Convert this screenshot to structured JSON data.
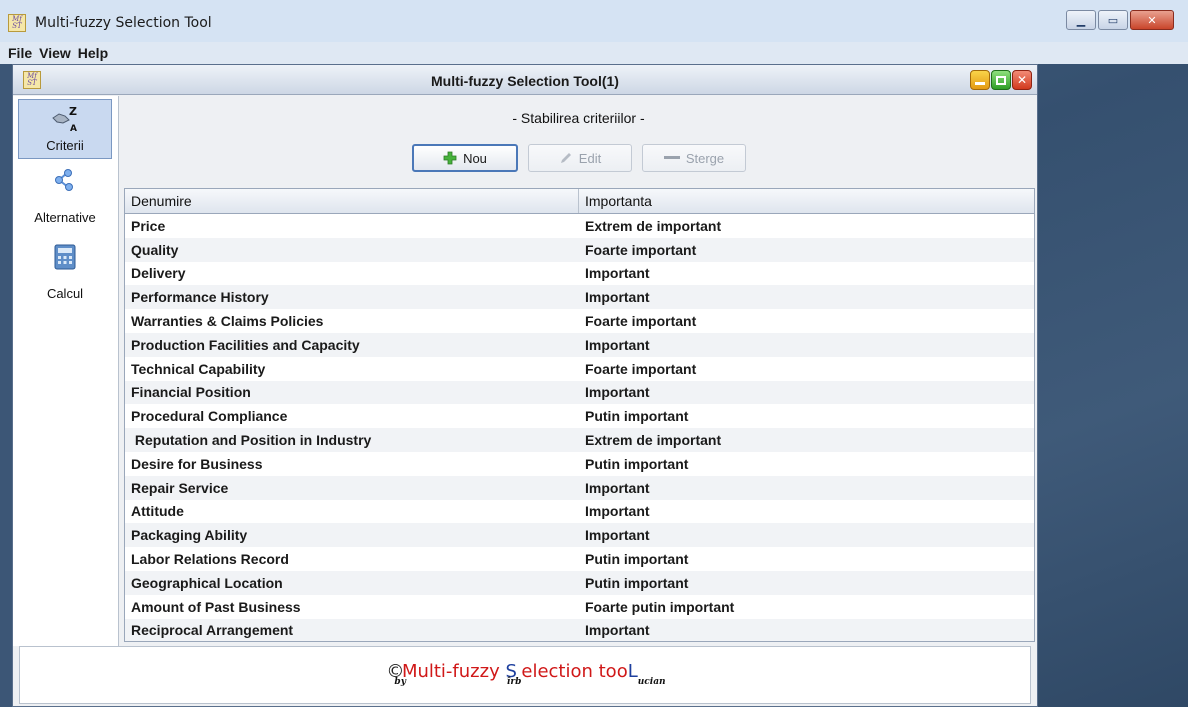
{
  "window": {
    "title": "Multi-fuzzy Selection Tool",
    "icon_text": "Mf ST",
    "controls": {
      "minimize_icon": "minimize-icon",
      "maximize_icon": "maximize-icon",
      "close_icon": "close-icon"
    }
  },
  "menubar": {
    "items": [
      "File",
      "View",
      "Help"
    ]
  },
  "internal_frame": {
    "title": "Multi-fuzzy Selection Tool(1)",
    "icon_text": "Mf ST"
  },
  "sidebar": {
    "items": [
      {
        "label": "Criterii",
        "icon": "sort-az-icon",
        "active": true
      },
      {
        "label": "Alternative",
        "icon": "share-nodes-icon",
        "active": false
      },
      {
        "label": "Calcul",
        "icon": "calculator-icon",
        "active": false
      }
    ]
  },
  "main": {
    "section_title": "- Stabilirea criteriilor -",
    "toolbar": {
      "new_label": "Nou",
      "edit_label": "Edit",
      "delete_label": "Sterge"
    },
    "table": {
      "columns": [
        "Denumire",
        "Importanta"
      ],
      "rows": [
        [
          "Price",
          "Extrem de important"
        ],
        [
          "Quality",
          "Foarte important"
        ],
        [
          "Delivery",
          "Important"
        ],
        [
          "Performance History",
          "Important"
        ],
        [
          "Warranties & Claims Policies",
          "Foarte important"
        ],
        [
          "Production Facilities and Capacity",
          "Important"
        ],
        [
          "Technical Capability",
          "Foarte important"
        ],
        [
          "Financial Position",
          "Important"
        ],
        [
          "Procedural Compliance",
          "Putin important"
        ],
        [
          " Reputation and Position in Industry",
          "Extrem de important"
        ],
        [
          "Desire for Business",
          "Putin important"
        ],
        [
          "Repair Service",
          "Important"
        ],
        [
          "Attitude",
          "Important"
        ],
        [
          "Packaging Ability",
          "Important"
        ],
        [
          "Labor Relations Record",
          "Putin important"
        ],
        [
          "Geographical Location",
          "Putin important"
        ],
        [
          "Amount of Past Business",
          "Foarte putin important"
        ],
        [
          "Reciprocal Arrangement",
          "Important"
        ]
      ]
    }
  },
  "footer": {
    "copyright": "©",
    "sub_by": "by",
    "main_red": "Multi-fuzzy",
    "s_letter": "S",
    "sub_irb": "îrb",
    "main_red2": "election too",
    "l_letter": "L",
    "sub_ucian": "ucian"
  },
  "colors": {
    "accent": "#4b78b8",
    "footer_red": "#d01818",
    "footer_blue": "#1d3f9e",
    "desktop": "#3f5a79"
  }
}
